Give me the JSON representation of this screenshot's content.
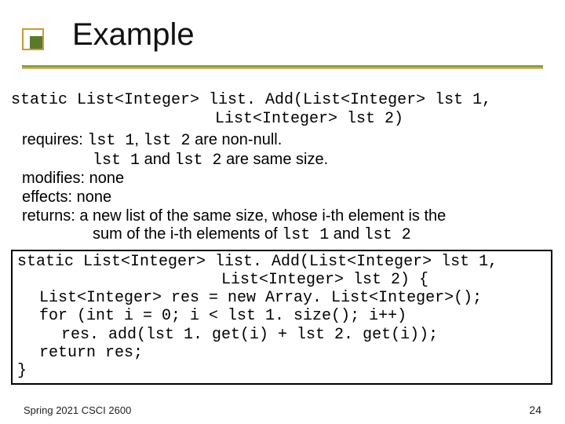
{
  "title": "Example",
  "signature": {
    "l1": "static List<Integer> list. Add(List<Integer> lst 1,",
    "l2": "List<Integer> lst 2)"
  },
  "spec": {
    "requires": {
      "kw": "requires:",
      "l1a": "lst 1",
      "l1b": ", ",
      "l1c": "lst 2",
      "l1d": " are non-null.",
      "l2a": "lst 1",
      "l2b": " and ",
      "l2c": "lst 2",
      "l2d": " are same size."
    },
    "modifies": {
      "kw": "modifies:",
      "text": " none"
    },
    "effects": {
      "kw": "effects:",
      "text": " none"
    },
    "returns": {
      "kw": "returns:",
      "l1": " a new list of the same size, whose i-th element is the",
      "l2a": "sum of the i-th elements of ",
      "l2b": "lst 1",
      "l2c": " and ",
      "l2d": "lst 2"
    }
  },
  "code": {
    "l1": "static List<Integer> list. Add(List<Integer> lst 1,",
    "l2": "List<Integer> lst 2) {",
    "l3": "List<Integer> res = new Array. List<Integer>();",
    "l4": "for (int i = 0; i < lst 1. size(); i++)",
    "l5": "res. add(lst 1. get(i) + lst 2. get(i));",
    "l6": "return res;",
    "l7": "}"
  },
  "footer": {
    "left": "Spring 2021 CSCI 2600",
    "right": "24"
  }
}
